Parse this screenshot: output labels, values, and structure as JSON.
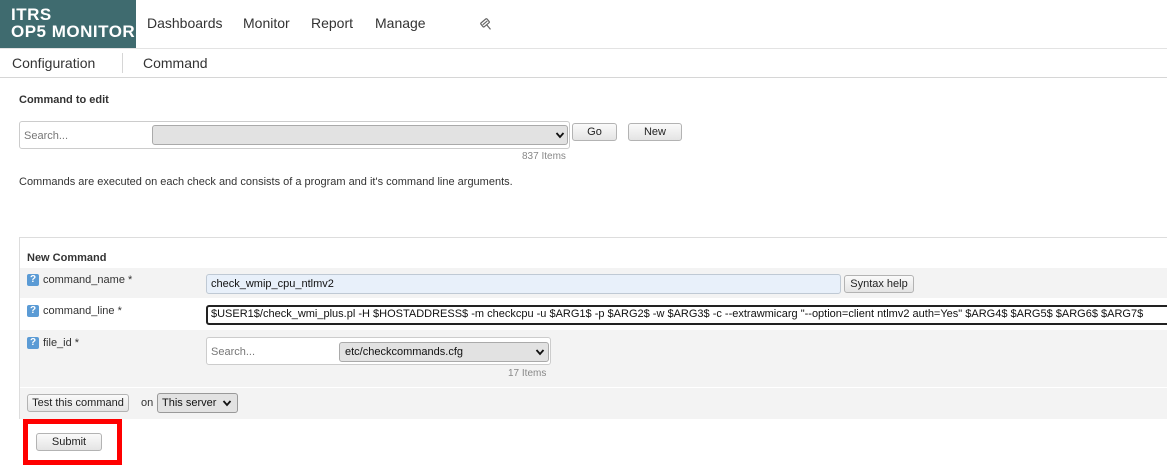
{
  "app": {
    "logo_line1": "ITRS",
    "logo_line2": "OP5 MONITOR",
    "brand_color": "#3f6b6f"
  },
  "nav": {
    "items": [
      "Dashboards",
      "Monitor",
      "Report",
      "Manage"
    ],
    "pin_icon": "pin-icon"
  },
  "breadcrumb": {
    "section": "Configuration",
    "page": "Command"
  },
  "command_picker": {
    "title": "Command to edit",
    "search_placeholder": "Search...",
    "selected": "",
    "go_label": "Go",
    "new_label": "New",
    "count": "837 Items"
  },
  "description": "Commands are executed on each check and consists of a program and it's command line arguments.",
  "form": {
    "title": "New Command",
    "command_name": {
      "label": "command_name *",
      "value": "check_wmip_cpu_ntlmv2",
      "syntax_help_label": "Syntax help"
    },
    "command_line": {
      "label": "command_line *",
      "value": "$USER1$/check_wmi_plus.pl -H $HOSTADDRESS$ -m checkcpu -u $ARG1$ -p $ARG2$ -w $ARG3$ -c --extrawmicarg \"--option=client ntlmv2 auth=Yes\" $ARG4$ $ARG5$ $ARG6$ $ARG7$"
    },
    "file_id": {
      "label": "file_id *",
      "search_placeholder": "Search...",
      "selected": "etc/checkcommands.cfg",
      "count": "17 Items"
    },
    "help_icon_text": "?",
    "test": {
      "button_label": "Test this command",
      "on_label": "on",
      "server_selected": "This server"
    },
    "submit_label": "Submit"
  },
  "highlight_color": "#ff0000"
}
